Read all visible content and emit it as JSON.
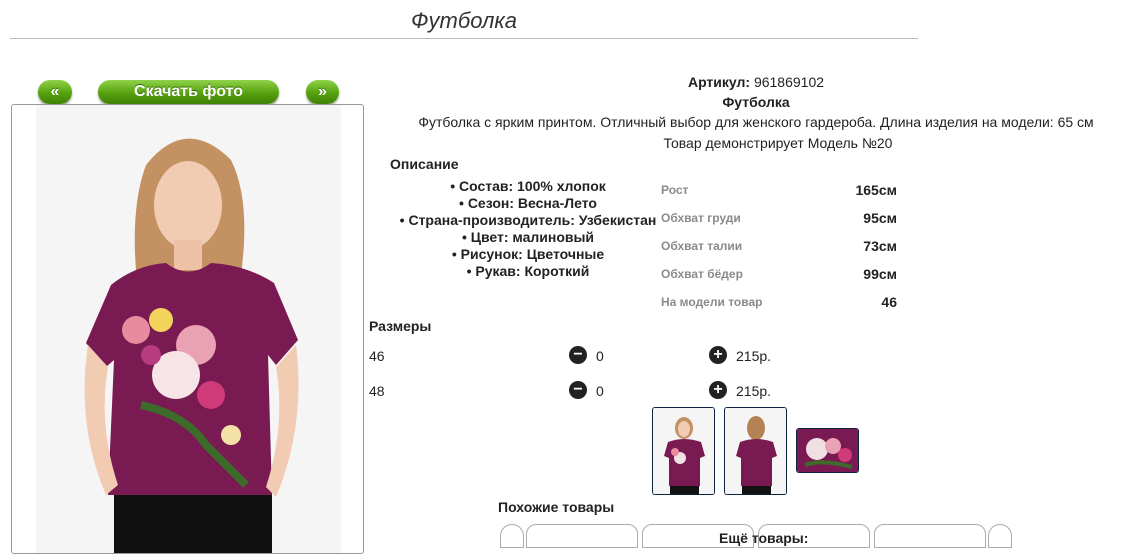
{
  "header": {
    "title": "Футболка"
  },
  "gallery": {
    "prev_label": "«",
    "download_label": "Скачать фото",
    "next_label": "»"
  },
  "product": {
    "article_label": "Артикул:",
    "article_value": "961869102",
    "name": "Футболка",
    "description": "Футболка с ярким принтом. Отличный выбор для женского гардероба. Длина изделия на модели: 65 см",
    "model_note": "Товар демонстрирует Модель №20"
  },
  "description": {
    "title": "Описание",
    "features": [
      "• Состав: 100% хлопок",
      "• Сезон: Весна-Лето",
      "• Страна-производитель: Узбекистан",
      "• Цвет: малиновый",
      "• Рисунок: Цветочные",
      "• Рукав: Короткий"
    ]
  },
  "measurements": [
    {
      "label": "Рост",
      "value": "165см"
    },
    {
      "label": "Обхват груди",
      "value": "95см"
    },
    {
      "label": "Обхват талии",
      "value": "73см"
    },
    {
      "label": "Обхват бёдер",
      "value": "99см"
    },
    {
      "label": "На модели товар",
      "value": "46"
    }
  ],
  "sizes": {
    "title": "Размеры",
    "rows": [
      {
        "size": "46",
        "qty": "0",
        "price": "215р."
      },
      {
        "size": "48",
        "qty": "0",
        "price": "215р."
      }
    ]
  },
  "colors": {
    "accent_green": "#56a10e",
    "shirt": "#7a1a52"
  },
  "related": {
    "similar_title": "Похожие товары",
    "more_title": "Ещё товары:"
  }
}
